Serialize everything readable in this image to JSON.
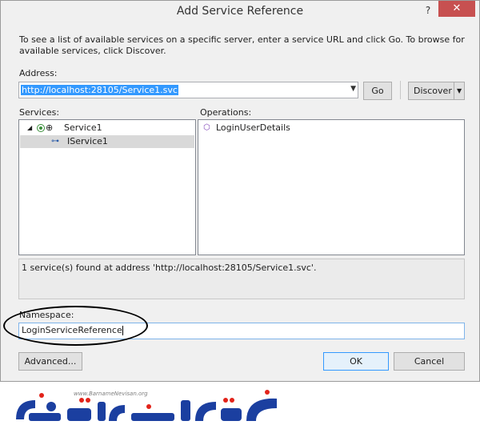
{
  "window": {
    "title": "Add Service Reference",
    "help_glyph": "?",
    "close_glyph": "✕"
  },
  "intro_text": "To see a list of available services on a specific server, enter a service URL and click Go. To browse for available services, click Discover.",
  "address": {
    "label": "Address:",
    "value": "http://localhost:28105/Service1.svc",
    "go_label": "Go",
    "discover_label": "Discover"
  },
  "services": {
    "label": "Services:",
    "items": [
      {
        "label": "Service1",
        "expanded": true
      },
      {
        "label": "IService1",
        "selected": true
      }
    ]
  },
  "operations": {
    "label": "Operations:",
    "items": [
      {
        "label": "LoginUserDetails"
      }
    ]
  },
  "status_text": "1 service(s) found at address 'http://localhost:28105/Service1.svc'.",
  "namespace": {
    "label": "Namespace:",
    "value": "LoginServiceReference"
  },
  "buttons": {
    "advanced": "Advanced...",
    "ok": "OK",
    "cancel": "Cancel"
  },
  "watermark": {
    "url": "www.BarnameNevisan.org",
    "logo_text": "برنامه نویسان",
    "colors": {
      "primary": "#1b3fa0",
      "accent": "#e2231a"
    }
  },
  "colors": {
    "selection": "#3399ff",
    "tree_selected_row": "#d9d9d9",
    "close_button": "#c75050",
    "dialog_bg": "#f0f0f0"
  }
}
